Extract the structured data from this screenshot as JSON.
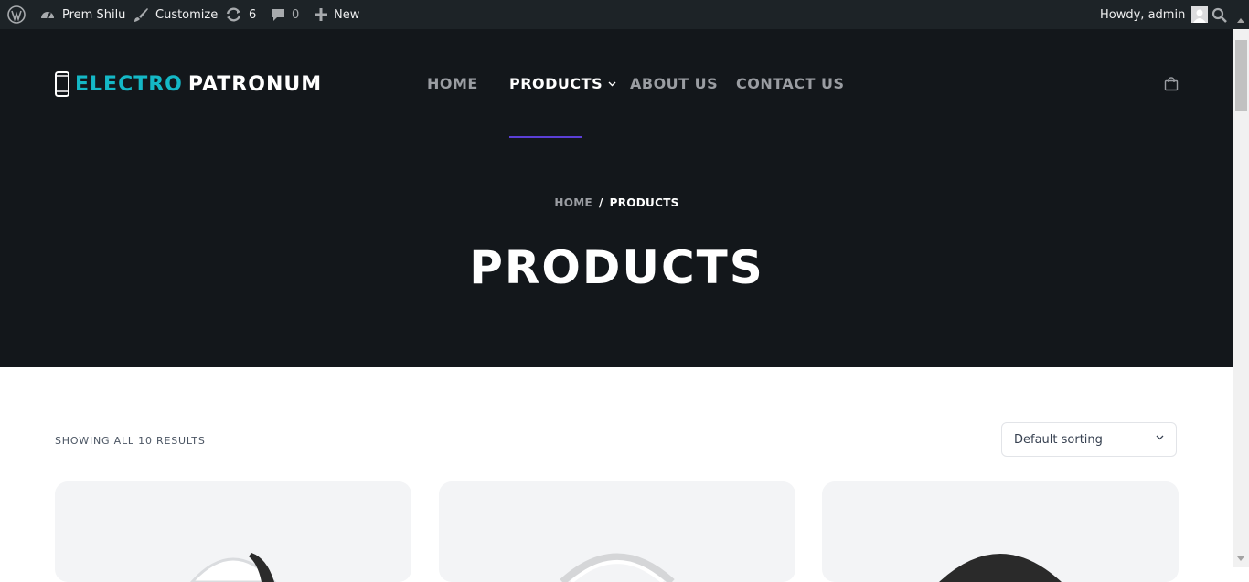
{
  "adminbar": {
    "wp_logo_icon": "wordpress-icon",
    "site_name": "Prem Shilu",
    "customize_label": "Customize",
    "updates_count": "6",
    "comments_count": "0",
    "new_label": "New",
    "howdy": "Howdy, admin"
  },
  "header": {
    "logo_part1": "ELECTRO",
    "logo_part2": "PATRONUM",
    "nav": {
      "home": "HOME",
      "products": "PRODUCTS",
      "about": "ABOUT US",
      "contact": "CONTACT US"
    }
  },
  "breadcrumb": {
    "home": "HOME",
    "separator": "/",
    "current": "PRODUCTS"
  },
  "page_title": "PRODUCTS",
  "shop": {
    "result_count": "SHOWING ALL 10 RESULTS",
    "sort_selected": "Default sorting"
  },
  "colors": {
    "adminbar_bg": "#1d2327",
    "hero_bg": "#13171b",
    "logo_accent": "#14b8c6",
    "nav_underline": "#5b3fd6",
    "card_bg": "#f3f4f6"
  }
}
